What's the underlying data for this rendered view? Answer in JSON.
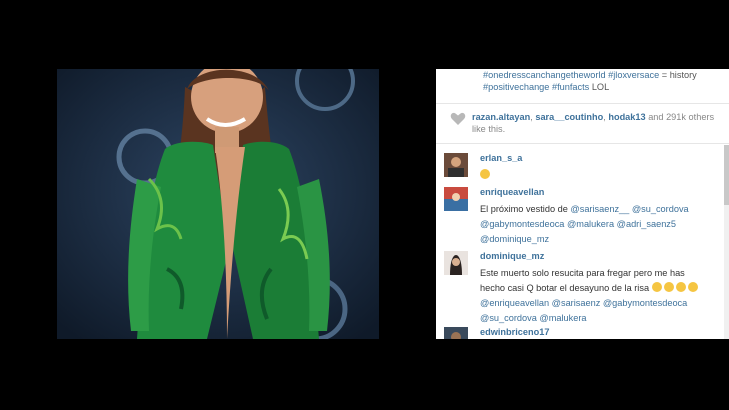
{
  "caption": {
    "line1": "#onedresscanchangetheworld #jlo",
    "line1b": "xversace",
    "line1c": "= history",
    "line2": "#positivechange #funfacts",
    "line2b": "LOL"
  },
  "likes": {
    "users": [
      "razan.altayan",
      "sara__coutinho",
      "hodak13"
    ],
    "suffix": "and 291k others like this."
  },
  "comments": [
    {
      "user": "erlan_s_a",
      "text": ""
    },
    {
      "user": "enriqueavellan",
      "text_a": "El próximo vestido de",
      "mentions_a": "@sarisaenz__ @su_cordova",
      "mentions_b": "@gabymontesdeoca @malukera @adri_saenz5",
      "mentions_c": "@dominique_mz"
    },
    {
      "user": "dominique_mz",
      "text_a": "Este muerto solo resucita para fregar pero me has",
      "text_b": "hecho casi Q botar el desayuno de la risa",
      "mentions_a": "@enriqueavellan @sarisaenz @gabymontesdeoca",
      "mentions_b": "@su_cordova @malukera"
    },
    {
      "user": "edwinbriceno17",
      "text": ""
    }
  ],
  "colors": {
    "link": "#3f729b",
    "background": "#000000",
    "panel": "#ffffff"
  },
  "icons": [
    "heart-icon",
    "smiley-emoji-icon",
    "laughing-emoji-icon"
  ]
}
